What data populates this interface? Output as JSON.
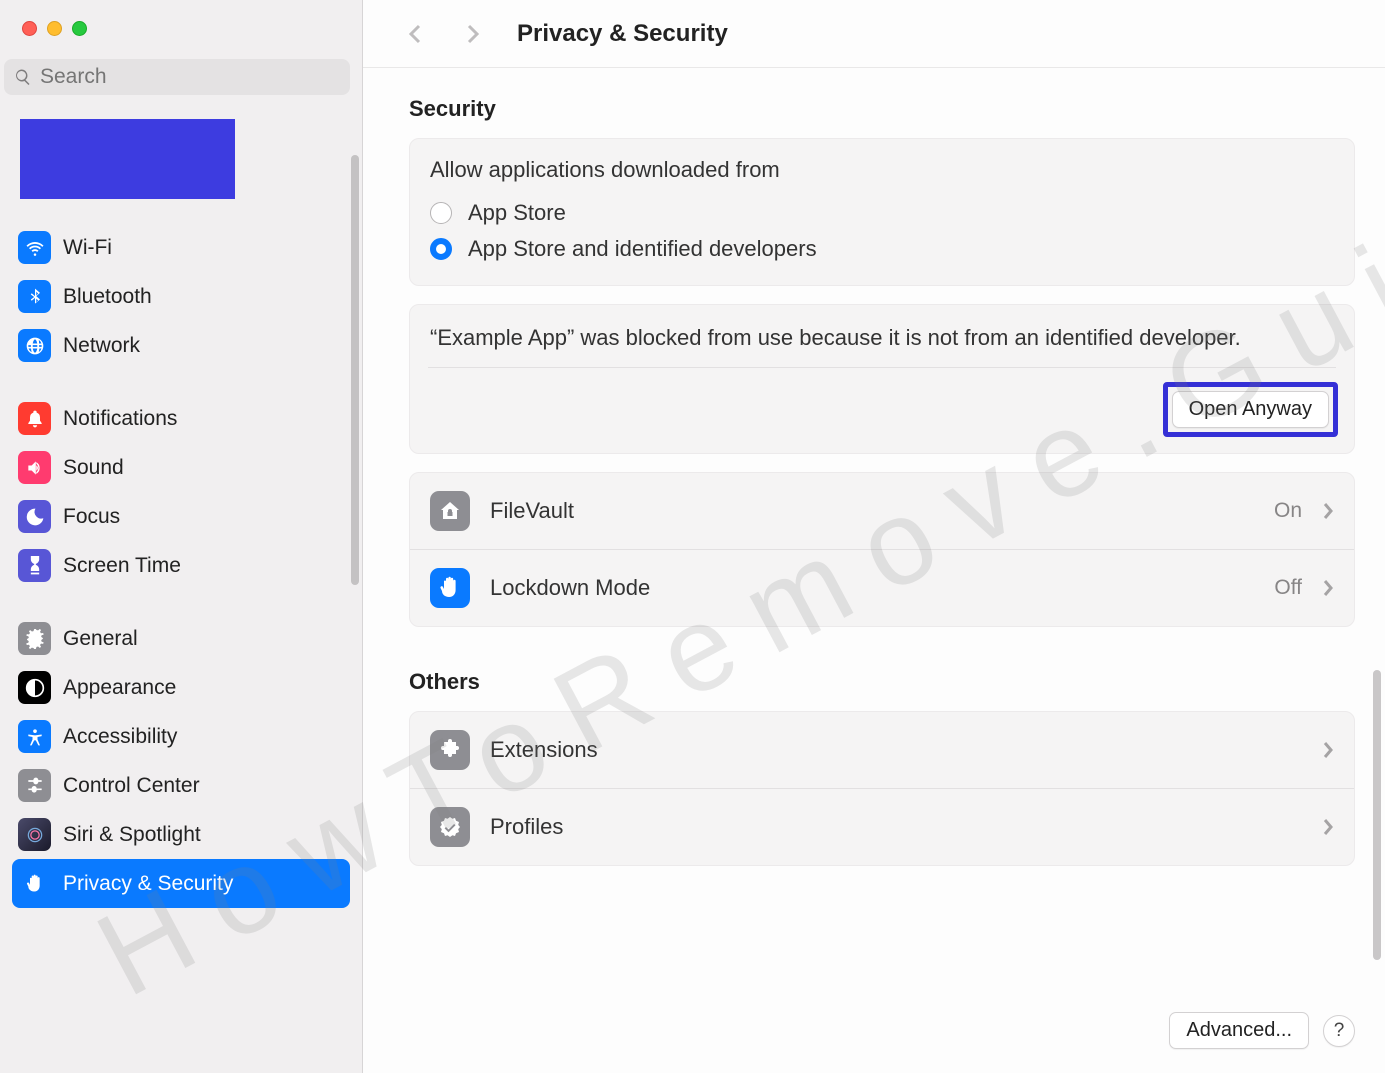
{
  "watermark": "HowToRemove.Guide",
  "search": {
    "placeholder": "Search"
  },
  "header": {
    "title": "Privacy & Security"
  },
  "sidebar": {
    "groups": [
      [
        {
          "id": "wifi",
          "label": "Wi-Fi",
          "color": "#0a7aff"
        },
        {
          "id": "bluetooth",
          "label": "Bluetooth",
          "color": "#0a7aff"
        },
        {
          "id": "network",
          "label": "Network",
          "color": "#0a7aff"
        }
      ],
      [
        {
          "id": "notifications",
          "label": "Notifications",
          "color": "#ff3b30"
        },
        {
          "id": "sound",
          "label": "Sound",
          "color": "#ff3b6f"
        },
        {
          "id": "focus",
          "label": "Focus",
          "color": "#5856d6"
        },
        {
          "id": "screentime",
          "label": "Screen Time",
          "color": "#5856d6"
        }
      ],
      [
        {
          "id": "general",
          "label": "General",
          "color": "#8e8e93"
        },
        {
          "id": "appearance",
          "label": "Appearance",
          "color": "#000000"
        },
        {
          "id": "accessibility",
          "label": "Accessibility",
          "color": "#0a7aff"
        },
        {
          "id": "controlcenter",
          "label": "Control Center",
          "color": "#8e8e93"
        },
        {
          "id": "siri",
          "label": "Siri & Spotlight",
          "color": "#222222"
        },
        {
          "id": "privacy",
          "label": "Privacy & Security",
          "color": "#0a7aff",
          "selected": true
        }
      ]
    ]
  },
  "security": {
    "title": "Security",
    "allow_title": "Allow applications downloaded from",
    "options": {
      "appstore": "App Store",
      "identified": "App Store and identified developers"
    },
    "selected": "identified",
    "blocked_msg": "“Example App” was blocked from use because it is not from an identified developer.",
    "open_anyway": "Open Anyway",
    "rows": {
      "filevault": {
        "label": "FileVault",
        "value": "On"
      },
      "lockdown": {
        "label": "Lockdown Mode",
        "value": "Off"
      }
    }
  },
  "others": {
    "title": "Others",
    "rows": {
      "extensions": {
        "label": "Extensions"
      },
      "profiles": {
        "label": "Profiles"
      }
    }
  },
  "footer": {
    "advanced": "Advanced...",
    "help": "?"
  }
}
